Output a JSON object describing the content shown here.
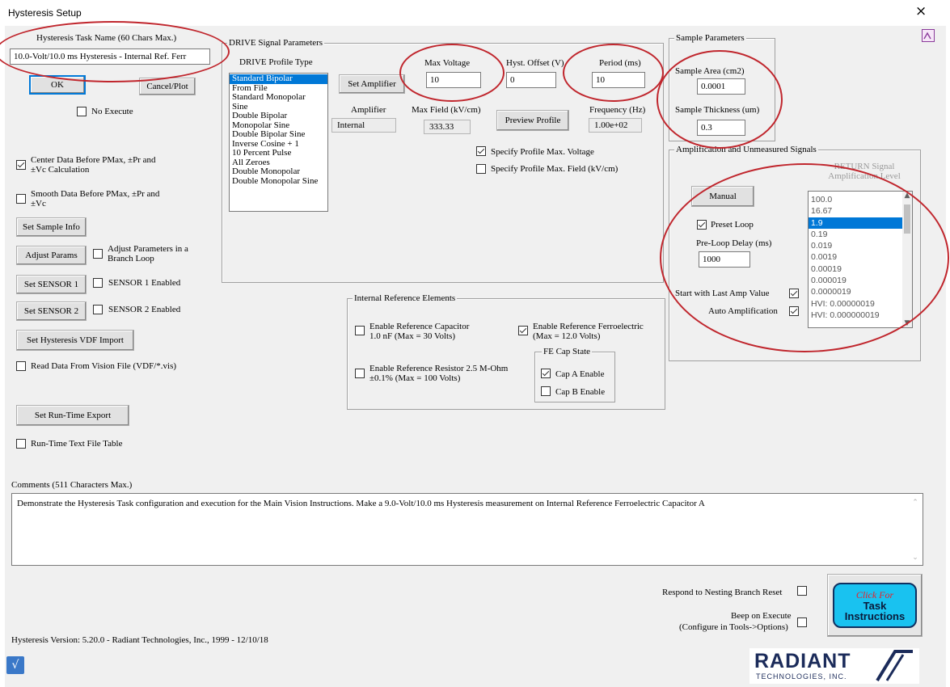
{
  "window": {
    "title": "Hysteresis Setup",
    "close_glyph": "×"
  },
  "task": {
    "name_label": "Hysteresis Task Name (60 Chars Max.)",
    "name_value": "10.0-Volt/10.0 ms Hysteresis - Internal Ref. Ferr",
    "ok_label": "OK",
    "cancel_label": "Cancel/Plot",
    "no_execute_label": "No Execute"
  },
  "left": {
    "center_data_label": "Center Data Before PMax, ±Pr and ±Vc Calculation",
    "smooth_data_label": "Smooth Data Before PMax, ±Pr and ±Vc",
    "set_sample_info": "Set Sample Info",
    "adjust_params": "Adjust Params",
    "adjust_branch_label": "Adjust Parameters in a Branch Loop",
    "set_sensor1": "Set SENSOR 1",
    "sensor1_enabled": "SENSOR 1 Enabled",
    "set_sensor2": "Set SENSOR 2",
    "sensor2_enabled": "SENSOR 2 Enabled",
    "set_vdf_import": "Set Hysteresis VDF Import",
    "read_vision_file": "Read Data From Vision File (VDF/*.vis)",
    "set_runtime_export": "Set Run-Time Export",
    "runtime_text_table": "Run-Time Text File Table"
  },
  "drive": {
    "group_title": "DRIVE Signal Parameters",
    "profile_type_label": "DRIVE Profile Type",
    "profiles": [
      "Standard Bipolar",
      "From File",
      "Standard Monopolar",
      "Sine",
      "Double Bipolar",
      "Monopolar Sine",
      "Double Bipolar Sine",
      "Inverse Cosine + 1",
      "10 Percent Pulse",
      "All Zeroes",
      "Double Monopolar",
      "Double Monopolar Sine"
    ],
    "selected_profile": "Standard Bipolar",
    "set_amplifier": "Set Amplifier",
    "max_voltage_label": "Max Voltage",
    "max_voltage": "10",
    "hyst_offset_label": "Hyst. Offset (V)",
    "hyst_offset": "0",
    "period_label": "Period (ms)",
    "period": "10",
    "amplifier_label": "Amplifier",
    "amplifier_value": "Internal",
    "max_field_label": "Max Field (kV/cm)",
    "max_field_value": "333.33",
    "preview_profile": "Preview Profile",
    "frequency_label": "Frequency (Hz)",
    "frequency_value": "1.00e+02",
    "specify_max_voltage": "Specify Profile Max. Voltage",
    "specify_max_field": "Specify Profile Max. Field (kV/cm)"
  },
  "sample": {
    "group_title": "Sample Parameters",
    "area_label": "Sample Area (cm2)",
    "area_value": "0.0001",
    "thickness_label": "Sample Thickness (um)",
    "thickness_value": "0.3"
  },
  "amp": {
    "group_title": "Amplification and Unmeasured Signals",
    "return_label": "RETURN Signal Amplification Level",
    "manual": "Manual",
    "preset_loop": "Preset Loop",
    "preloop_delay_label": "Pre-Loop Delay (ms)",
    "preloop_delay": "1000",
    "start_last_amp": "Start with Last Amp Value",
    "auto_amplification": "Auto Amplification",
    "levels": [
      "100.0",
      "16.67",
      "1.9",
      "0.19",
      "0.019",
      "0.0019",
      "0.00019",
      "0.000019",
      "0.0000019",
      "HVI: 0.00000019",
      "HVI: 0.000000019"
    ],
    "selected_level": "1.9"
  },
  "internal_ref": {
    "group_title": "Internal Reference Elements",
    "ref_cap": "Enable Reference Capacitor 1.0 nF (Max = 30 Volts)",
    "ref_fe": "Enable Reference Ferroelectric (Max = 12.0 Volts)",
    "ref_res": "Enable Reference Resistor 2.5 M-Ohm ±0.1% (Max = 100 Volts)",
    "fe_cap_state": "FE Cap State",
    "cap_a": "Cap A Enable",
    "cap_b": "Cap B Enable"
  },
  "comments": {
    "label": "Comments (511 Characters Max.)",
    "text": "Demonstrate the Hysteresis Task configuration and execution for the Main Vision Instructions. Make a 9.0-Volt/10.0 ms Hysteresis measurement on Internal Reference Ferroelectric Capacitor A"
  },
  "footer": {
    "respond_nesting": "Respond to Nesting Branch Reset",
    "beep_execute": "Beep on Execute",
    "configure_tools": "(Configure in Tools->Options)",
    "version": "Hysteresis Version: 5.20.0 - Radiant Technologies, Inc., 1999 - 12/10/18",
    "instructions_click": "Click For",
    "instructions_task": "Task",
    "instructions_word": "Instructions",
    "logo_main": "RADIANT",
    "logo_sub": "TECHNOLOGIES, INC."
  },
  "colors": {
    "accent_red": "#c0262d",
    "select_blue": "#0078d7",
    "instr_cyan": "#19c2f0"
  }
}
